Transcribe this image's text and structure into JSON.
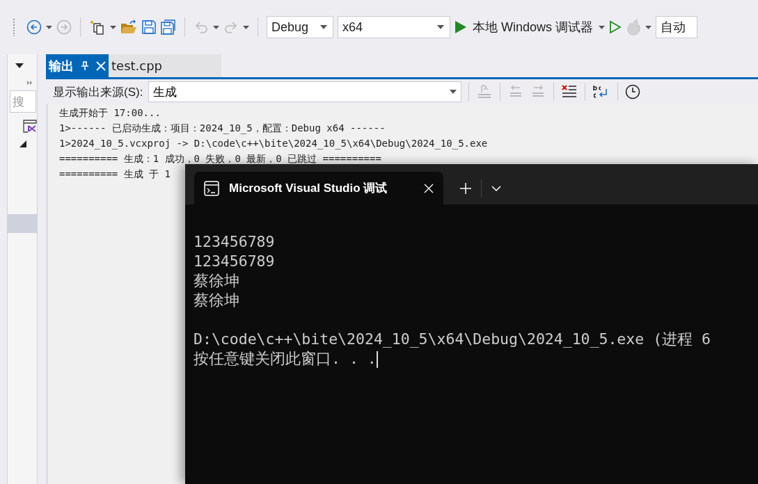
{
  "toolbar": {
    "items": [
      {
        "kind": "back",
        "disabled": false,
        "dropdown": true
      },
      {
        "kind": "forward",
        "disabled": true,
        "dropdown": false
      },
      {
        "kind": "separator"
      },
      {
        "kind": "new-item",
        "disabled": false,
        "dropdown": true
      },
      {
        "kind": "open",
        "disabled": false,
        "dropdown": false
      },
      {
        "kind": "save",
        "disabled": false,
        "dropdown": false
      },
      {
        "kind": "save-all",
        "disabled": false,
        "dropdown": false
      },
      {
        "kind": "separator"
      },
      {
        "kind": "undo",
        "disabled": true,
        "dropdown": true
      },
      {
        "kind": "redo",
        "disabled": true,
        "dropdown": true
      },
      {
        "kind": "separator"
      },
      {
        "kind": "combo",
        "value": "Debug"
      },
      {
        "kind": "combo",
        "value": "x64"
      },
      {
        "kind": "start",
        "label": "本地 Windows 调试器",
        "dropdown": true
      },
      {
        "kind": "start-no-debug",
        "disabled": false,
        "dropdown": false
      },
      {
        "kind": "hot-reload",
        "disabled": true,
        "dropdown": true
      },
      {
        "kind": "combo",
        "value": "自动"
      }
    ]
  },
  "sidebar": {
    "search": {
      "placeholder": "搜"
    },
    "tree_expanded": true
  },
  "output": {
    "tabs": [
      {
        "label": "输出",
        "selected": true
      },
      {
        "label": "test.cpp",
        "selected": false
      }
    ],
    "source_label": "显示输出来源(S):",
    "source_value": "生成",
    "tools": [
      {
        "kind": "goto-line",
        "disabled": true
      },
      {
        "kind": "separator"
      },
      {
        "kind": "prev-message",
        "disabled": true
      },
      {
        "kind": "next-message",
        "disabled": true
      },
      {
        "kind": "separator"
      },
      {
        "kind": "clear-all",
        "disabled": false
      },
      {
        "kind": "separator"
      },
      {
        "kind": "word-wrap",
        "disabled": false
      },
      {
        "kind": "separator"
      },
      {
        "kind": "history",
        "disabled": false
      }
    ],
    "lines": [
      "生成开始于 17:00...",
      "1>------ 已启动生成：项目：2024_10_5，配置：Debug x64 ------",
      "1>2024_10_5.vcxproj -> D:\\code\\c++\\bite\\2024_10_5\\x64\\Debug\\2024_10_5.exe",
      "========== 生成：1 成功，0 失败，0 最新，0 已跳过 ==========",
      "========== 生成 于 1"
    ]
  },
  "console": {
    "tab_title": "Microsoft Visual Studio 调试",
    "lines": [
      "123456789",
      "123456789",
      "蔡徐坤",
      "蔡徐坤"
    ],
    "exit_message": "D:\\code\\c++\\bite\\2024_10_5\\x64\\Debug\\2024_10_5.exe (进程 6",
    "prompt": "按任意键关闭此窗口. . ."
  }
}
